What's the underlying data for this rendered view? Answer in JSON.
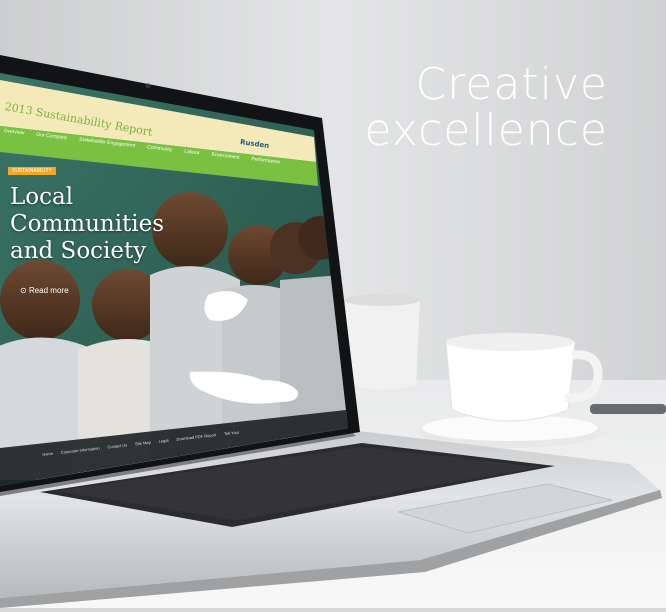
{
  "headline": {
    "line1": "Creative",
    "line2": "excellence"
  },
  "laptop_screen": {
    "report_title": "2013 Sustainability Report",
    "nav": [
      "Overview",
      "Our Company",
      "Stakeholder Engagement",
      "Community",
      "Labour",
      "Environment",
      "Performance"
    ],
    "brand": "Rusden",
    "badge": "SUSTAINABILITY",
    "hero_line1": "Local",
    "hero_line2": "Communities",
    "hero_line3": "and Society",
    "read_more": "Read more",
    "footer_links": [
      "Home",
      "Corporate Information",
      "Contact Us",
      "Site Map",
      "Legal",
      "Download PDF Report",
      "Tell Your"
    ]
  },
  "colors": {
    "accent_green": "#7ac142",
    "header_yellow": "#f4e9b8",
    "screen_bg": "#2f6a5a",
    "wall": "#d5d6d7",
    "table": "#f2f2f2"
  }
}
